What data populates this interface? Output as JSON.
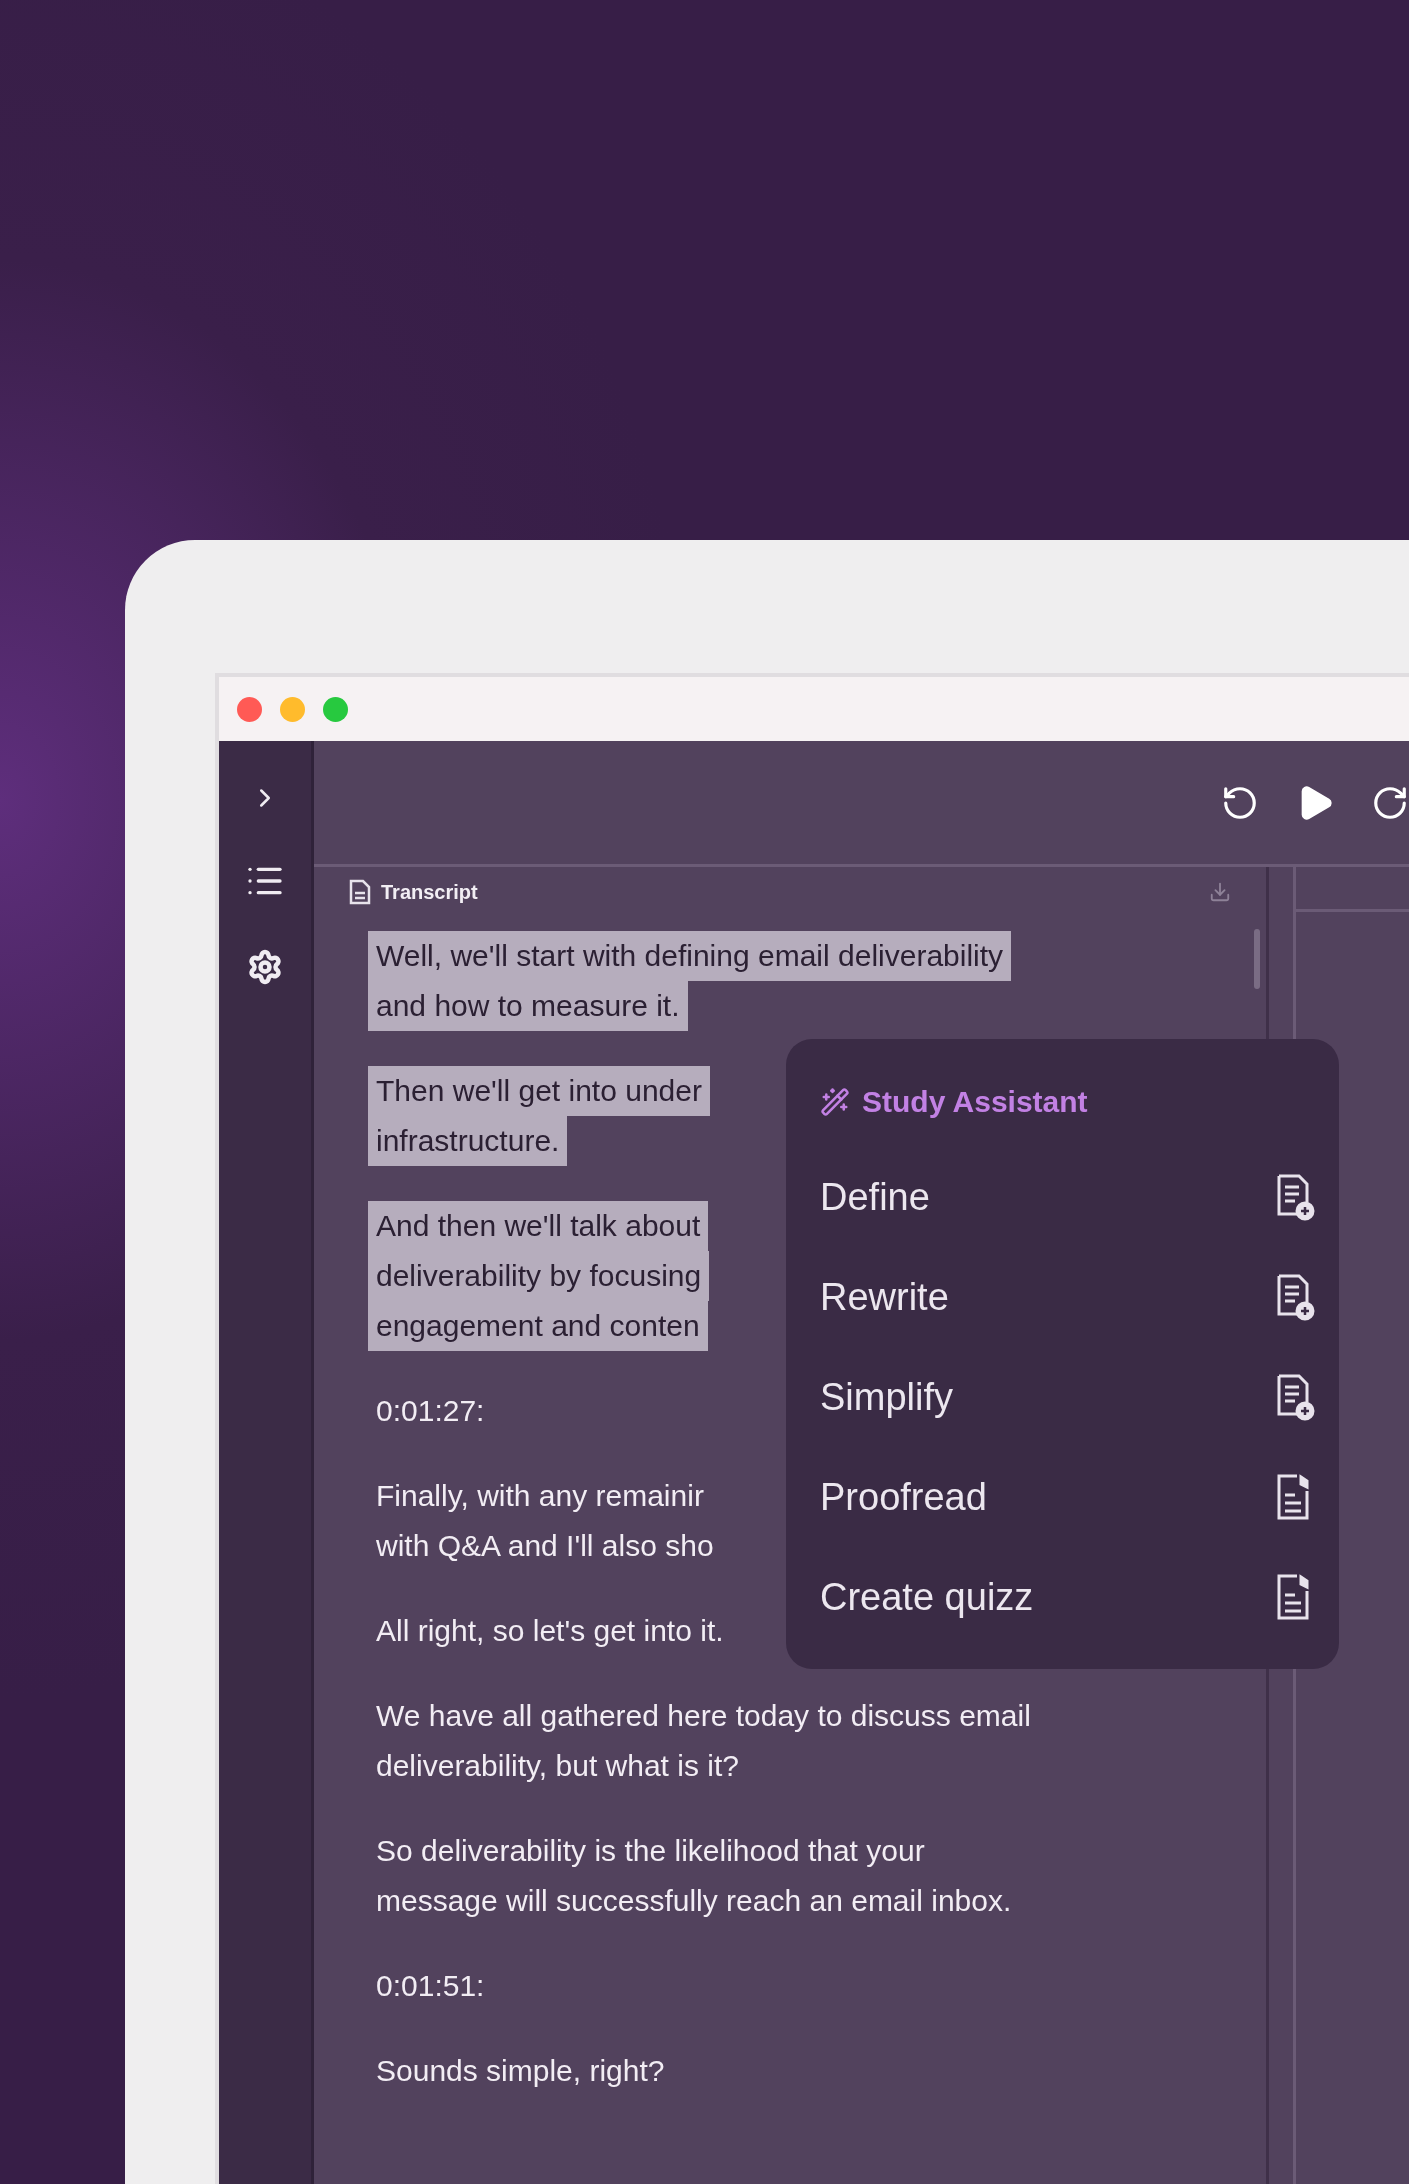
{
  "toolbar": {
    "title": "Transcript"
  },
  "transcript": {
    "paragraphs": [
      {
        "lines": [
          "Well, we'll start with defining email deliverability",
          "and how to measure it."
        ],
        "selected": true
      },
      {
        "lines": [
          "Then we'll get into under",
          "infrastructure."
        ],
        "selected": true
      },
      {
        "lines": [
          "And then we'll talk about",
          "deliverability by focusing",
          "engagement and conten"
        ],
        "selected": true
      },
      {
        "lines": [
          "0:01:27:"
        ],
        "selected": false
      },
      {
        "lines": [
          "Finally, with any remainir",
          "with Q&A and I'll also sho"
        ],
        "selected": false
      },
      {
        "lines": [
          "All right, so let's get into it."
        ],
        "selected": false
      },
      {
        "lines": [
          "We have all gathered here today to discuss email",
          "deliverability, but what is it?"
        ],
        "selected": false
      },
      {
        "lines": [
          "So deliverability is the likelihood that your",
          "message will successfully reach an email inbox."
        ],
        "selected": false
      },
      {
        "lines": [
          "0:01:51:"
        ],
        "selected": false
      },
      {
        "lines": [
          "Sounds simple, right?"
        ],
        "selected": false
      }
    ]
  },
  "study_assistant": {
    "title": "Study Assistant",
    "items": [
      {
        "label": "Define",
        "kind": "add"
      },
      {
        "label": "Rewrite",
        "kind": "add"
      },
      {
        "label": "Simplify",
        "kind": "add"
      },
      {
        "label": "Proofread",
        "kind": "audio"
      },
      {
        "label": "Create quizz",
        "kind": "audio"
      }
    ]
  }
}
